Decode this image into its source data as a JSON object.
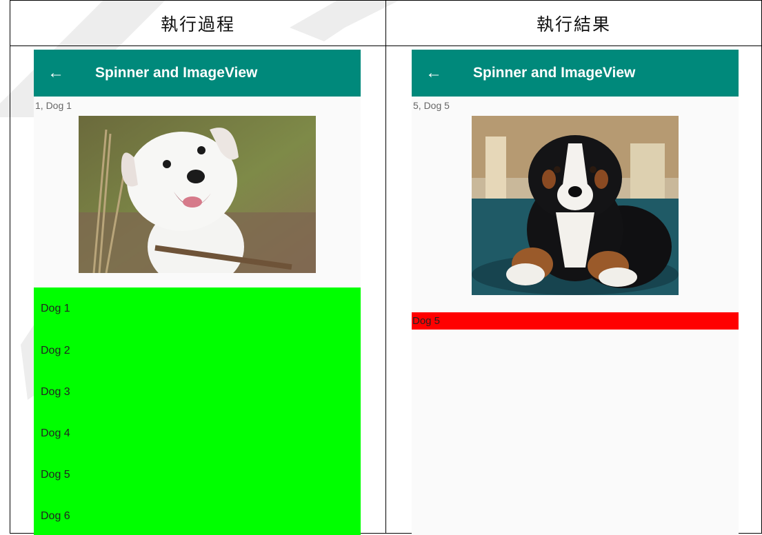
{
  "headers": {
    "left": "執行過程",
    "right": "執行結果"
  },
  "left_phone": {
    "title": "Spinner and ImageView",
    "selected_text": "1, Dog 1",
    "dropdown_items": [
      "Dog 1",
      "Dog 2",
      "Dog 3",
      "Dog 4",
      "Dog 5",
      "Dog 6"
    ],
    "dropdown_color": "#00ff00"
  },
  "right_phone": {
    "title": "Spinner and ImageView",
    "selected_text": "5, Dog 5",
    "spinner_value": "Dog 5",
    "spinner_color": "#ff0000"
  },
  "colors": {
    "appbar": "#00897b",
    "background": "#fafafa"
  },
  "icons": {
    "back": "arrow-left-icon"
  }
}
